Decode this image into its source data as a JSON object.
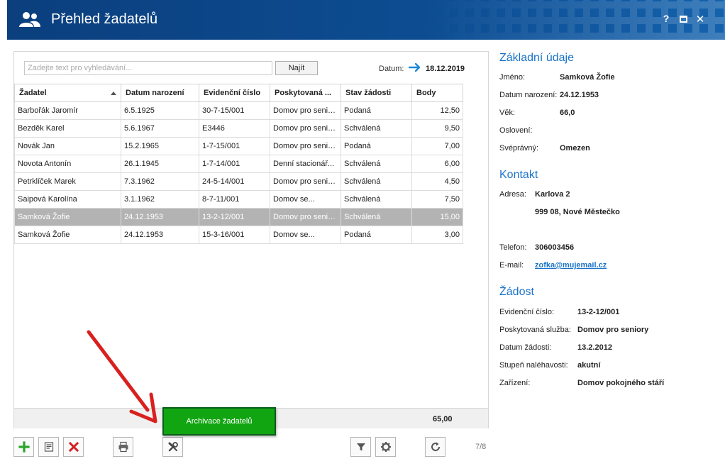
{
  "window": {
    "title": "Přehled žadatelů",
    "help_label": "?",
    "close_label": "✕"
  },
  "search": {
    "placeholder": "Zadejte text pro vyhledávání...",
    "find_label": "Najít",
    "date_label": "Datum:",
    "date_value": "18.12.2019"
  },
  "grid": {
    "columns": [
      "Žadatel",
      "Datum narození",
      "Evidenční číslo",
      "Poskytovaná ...",
      "Stav žádosti",
      "Body"
    ],
    "rows": [
      [
        "Barbořák Jaromír",
        "6.5.1925",
        "30-7-15/001",
        "Domov pro seniory",
        "Podaná",
        "12,50"
      ],
      [
        "Bezděk Karel",
        "5.6.1967",
        "E3446",
        "Domov pro seniory",
        "Schválená",
        "9,50"
      ],
      [
        "Novák Jan",
        "15.2.1965",
        "1-7-15/001",
        "Domov pro seniory",
        "Podaná",
        "7,00"
      ],
      [
        "Novota Antonín",
        "26.1.1945",
        "1-7-14/001",
        "Denní stacionář...",
        "Schválená",
        "6,00"
      ],
      [
        "Petrklíček Marek",
        "7.3.1962",
        "24-5-14/001",
        "Domov pro seniory",
        "Schválená",
        "4,50"
      ],
      [
        "Saipová Karolína",
        "3.1.1962",
        "8-7-11/001",
        "Domov se...",
        "Schválená",
        "7,50"
      ],
      [
        "Samková Žofie",
        "24.12.1953",
        "13-2-12/001",
        "Domov pro seniory",
        "Schválená",
        "15,00"
      ],
      [
        "Samková Žofie",
        "24.12.1953",
        "15-3-16/001",
        "Domov se...",
        "Podaná",
        "3,00"
      ]
    ],
    "selected_row": 6,
    "sum": "65,00"
  },
  "toolbar": {
    "tooltip": "Archivace žadatelů",
    "page_count": "7/8"
  },
  "details": {
    "basic": {
      "title": "Základní údaje",
      "name_label": "Jméno:",
      "name": "Samková Žofie",
      "birth_label": "Datum narození:",
      "birth": "24.12.1953",
      "age_label": "Věk:",
      "age": "66,0",
      "salutation_label": "Oslovení:",
      "competence_label": "Svéprávný:",
      "competence": "Omezen"
    },
    "contact": {
      "title": "Kontakt",
      "address_label": "Adresa:",
      "address_line1": "Karlova 2",
      "address_line2": "999 08, Nové Městečko",
      "phone_label": "Telefon:",
      "phone": "306003456",
      "email_label": "E-mail:",
      "email": "zofka@mujemail.cz"
    },
    "request": {
      "title": "Žádost",
      "reg_label": "Evidenční číslo:",
      "reg": "13-2-12/001",
      "service_label": "Poskytovaná služba:",
      "service": "Domov pro seniory",
      "date_label": "Datum žádosti:",
      "date": "13.2.2012",
      "urgency_label": "Stupeň naléhavosti:",
      "urgency": "akutní",
      "facility_label": "Zařízení:",
      "facility": "Domov pokojného stáří"
    }
  },
  "colors": {
    "title_bar": "#0a4a8c",
    "accent": "#1a73c8",
    "selected_row": "#b3b3b3",
    "tooltip": "#12a512",
    "arrow": "#d9201f"
  }
}
